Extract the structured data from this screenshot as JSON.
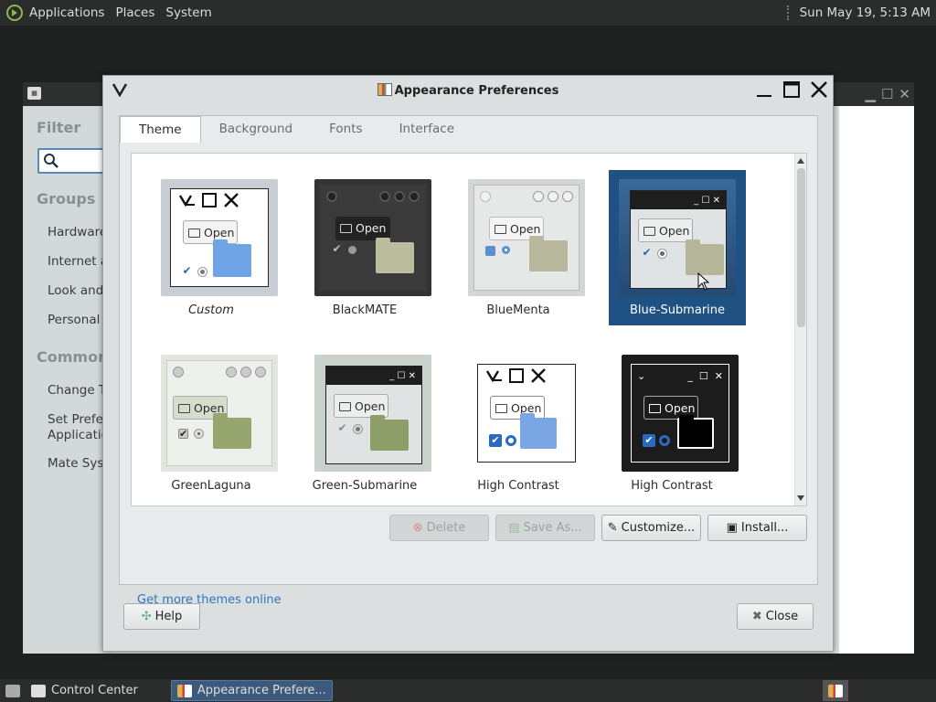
{
  "top_panel": {
    "menus": [
      "Applications",
      "Places",
      "System"
    ],
    "clock": "Sun May 19,  5:13 AM"
  },
  "control_center": {
    "filter_title": "Filter",
    "groups_title": "Groups",
    "groups": [
      "Hardware",
      "Internet a",
      "Look and",
      "Personal"
    ],
    "common_title": "Common T",
    "common_items": [
      "Change Th",
      "Set Prefer",
      "Applicatio",
      "Mate Syste"
    ]
  },
  "dialog": {
    "title": "Appearance Preferences",
    "tabs": [
      "Theme",
      "Background",
      "Fonts",
      "Interface"
    ],
    "active_tab": "Theme",
    "themes": [
      {
        "name": "Custom",
        "selected": false
      },
      {
        "name": "BlackMATE",
        "selected": false
      },
      {
        "name": "BlueMenta",
        "selected": false
      },
      {
        "name": "Blue-Submarine",
        "selected": true
      },
      {
        "name": "GreenLaguna",
        "selected": false
      },
      {
        "name": "Green-Submarine",
        "selected": false
      },
      {
        "name": "High Contrast",
        "selected": false
      },
      {
        "name": "High Contrast",
        "selected": false
      }
    ],
    "preview_open_label": "Open",
    "buttons": {
      "delete": "Delete",
      "save_as": "Save As...",
      "customize": "Customize...",
      "install": "Install..."
    },
    "get_more": "Get more themes online",
    "help": "Help",
    "close": "Close"
  },
  "taskbar": {
    "items": [
      "Control Center",
      "Appearance Prefere..."
    ]
  },
  "colors": {
    "selection": "#1f5283",
    "link": "#2a78c0",
    "panel": "#2b2d2c"
  }
}
